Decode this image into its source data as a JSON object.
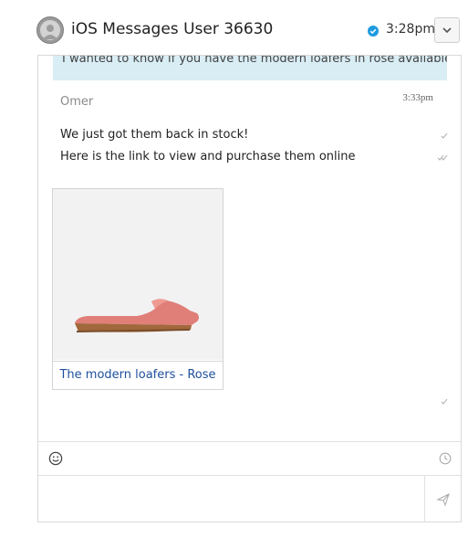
{
  "header": {
    "title": "iOS Messages User 36630",
    "time": "3:28pm",
    "verified_icon": "check-circle-icon",
    "dropdown_icon": "chevron-down-icon"
  },
  "conversation": {
    "previous_message": "I wanted to know if you have the modern loafers in rose available?",
    "sender": "Omer",
    "time": "3:33pm",
    "messages": [
      {
        "text": "We just got them back in stock!",
        "status_icon": "single-check-icon"
      },
      {
        "text": "Here is the link to view and purchase them online",
        "status_icon": "double-check-icon"
      }
    ],
    "product_card": {
      "link_text": "The modern loafers - Rose",
      "image_icon": "shoe-image",
      "status_icon": "single-check-icon"
    }
  },
  "composer": {
    "emoji_icon": "smiley-icon",
    "clock_icon": "clock-icon",
    "send_icon": "send-icon"
  },
  "colors": {
    "highlight_bg": "#d9edf5",
    "link": "#1d4f9c",
    "verified": "#1e9be0",
    "shoe": "#e07e78"
  }
}
